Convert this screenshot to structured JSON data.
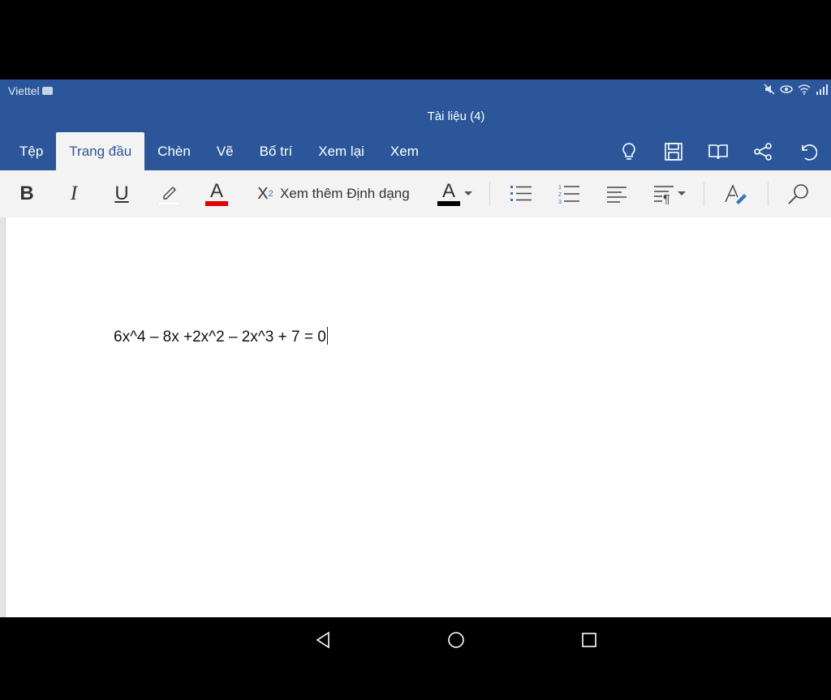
{
  "status_bar": {
    "carrier": "Viettel",
    "carrier_badge": "VoLTE"
  },
  "document_title": "Tài liệu (4)",
  "tabs": [
    {
      "label": "Tệp",
      "active": false
    },
    {
      "label": "Trang đầu",
      "active": true
    },
    {
      "label": "Chèn",
      "active": false
    },
    {
      "label": "Vẽ",
      "active": false
    },
    {
      "label": "Bố trí",
      "active": false
    },
    {
      "label": "Xem lại",
      "active": false
    },
    {
      "label": "Xem",
      "active": false
    }
  ],
  "header_icons": [
    "lightbulb-icon",
    "save-icon",
    "read-mode-icon",
    "share-icon",
    "undo-icon"
  ],
  "ribbon": {
    "bold": "B",
    "italic": "I",
    "underline": "U",
    "font_color_letter": "A",
    "subscript": "X",
    "subscript_digit": "2",
    "more_formatting": "Xem thêm Định dạng",
    "style_letter": "A",
    "highlight_color": "#ffffff",
    "font_color": "#e00000",
    "style_color": "#000000"
  },
  "document": {
    "text": "6x^4 – 8x +2x^2 – 2x^3 + 7 = 0"
  },
  "colors": {
    "header": "#2b579a",
    "ribbon": "#f3f3f3",
    "accent_blue": "#2b78c6"
  }
}
